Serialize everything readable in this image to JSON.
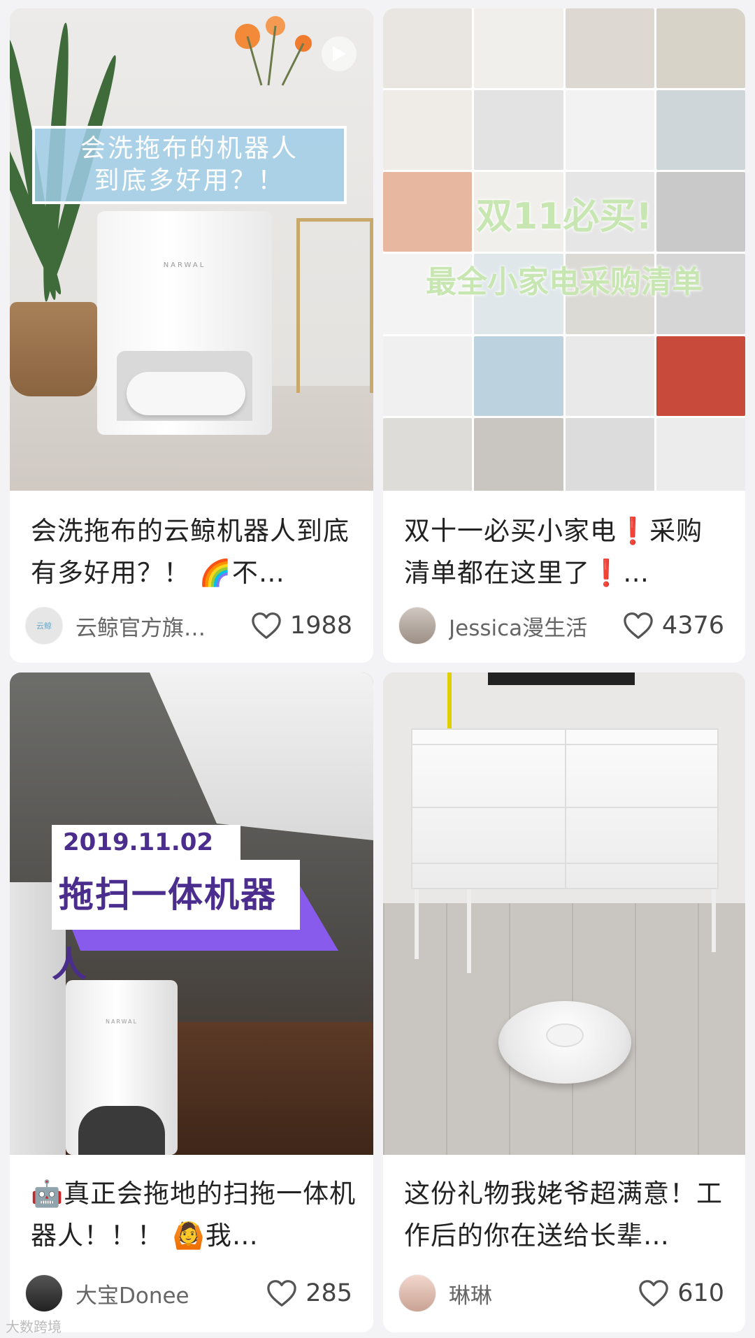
{
  "feed": {
    "cards": [
      {
        "title": "会洗拖布的云鲸机器人到底有多好用？！ 🌈不…",
        "image_text": [
          "会洗拖布的机器人",
          "到底多好用？！"
        ],
        "image_brand": "NARWAL",
        "is_video": true,
        "author": "云鲸官方旗…",
        "avatar_text": "云鲸",
        "likes": "1988"
      },
      {
        "title": "双十一必买小家电❗️采购清单都在这里了❗️…",
        "image_text": [
          "双11必买!",
          "最全小家电采购清单"
        ],
        "author": "Jessica漫生活",
        "likes": "4376"
      },
      {
        "title": "🤖真正会拖地的扫拖一体机器人！！！ 🙆我…",
        "image_text": [
          "2019.11.02",
          "拖扫一体机器人"
        ],
        "image_brand": "NARWAL",
        "author": "大宝Donee",
        "likes": "285"
      },
      {
        "title": "这份礼物我姥爷超满意！工作后的你在送给长辈…",
        "author": "琳琳",
        "likes": "610"
      }
    ]
  },
  "watermark": "大数跨境",
  "colors": {
    "background": "#f3f3f5",
    "card": "#ffffff",
    "title_text": "#222222",
    "meta_text": "#666666",
    "accent_purple": "#8b5cf6",
    "banner_blue": "#a0cde8"
  },
  "icons": {
    "like": "heart-outline-icon",
    "video": "play-icon"
  }
}
